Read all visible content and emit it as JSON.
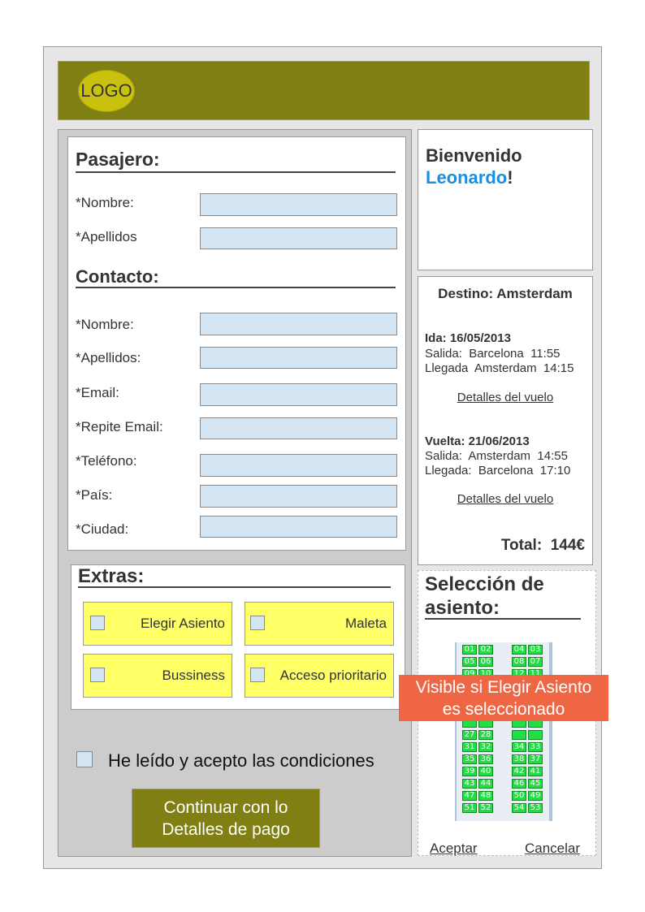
{
  "header": {
    "logo_text": "LOGO"
  },
  "pasajero": {
    "title": "Pasajero:",
    "fields": [
      {
        "label": "*Nombre:",
        "value": ""
      },
      {
        "label": "*Apellidos",
        "value": ""
      }
    ]
  },
  "contacto": {
    "title": "Contacto:",
    "fields": [
      {
        "label": "*Nombre:",
        "value": ""
      },
      {
        "label": "*Apellidos:",
        "value": ""
      },
      {
        "label": "*Email:",
        "value": ""
      },
      {
        "label": "*Repite Email:",
        "value": ""
      },
      {
        "label": "*Teléfono:",
        "value": ""
      },
      {
        "label": "*País:",
        "value": ""
      },
      {
        "label": "*Ciudad:",
        "value": ""
      }
    ]
  },
  "extras": {
    "title": "Extras:",
    "items": [
      {
        "label": "Elegir Asiento",
        "checked": false
      },
      {
        "label": "Maleta",
        "checked": false
      },
      {
        "label": "Bussiness",
        "checked": false
      },
      {
        "label": "Acceso prioritario",
        "checked": false
      }
    ]
  },
  "conditions": {
    "label": "He leído y acepto las condiciones",
    "checked": false
  },
  "continue_button": {
    "line1": "Continuar con lo",
    "line2": "Detalles de pago"
  },
  "welcome": {
    "greeting": "Bienvenido",
    "user_name": "Leonardo",
    "suffix": "!"
  },
  "flight": {
    "destination": "Destino: Amsterdam",
    "outbound": {
      "title": "Ida: 16/05/2013",
      "departure": "Salida:  Barcelona  11:55",
      "arrival": "Llegada  Amsterdam  14:15",
      "details_link": "Detalles del vuelo"
    },
    "return": {
      "title": "Vuelta: 21/06/2013",
      "departure": "Salida:  Amsterdam  14:55",
      "arrival": "Llegada:  Barcelona  17:10",
      "details_link": "Detalles del vuelo"
    },
    "total_label": "Total:",
    "total_value": "144€"
  },
  "seat_selection": {
    "title_line1": "Selección de",
    "title_line2": "asiento:",
    "seat_rows": [
      [
        "01",
        "02",
        "04",
        "03"
      ],
      [
        "05",
        "06",
        "08",
        "07"
      ],
      [
        "09",
        "10",
        "12",
        "11"
      ],
      [
        "",
        "",
        "",
        ""
      ],
      [
        "",
        "",
        "",
        ""
      ],
      [
        "",
        "",
        "",
        ""
      ],
      [
        "",
        "",
        "",
        ""
      ],
      [
        "27",
        "28",
        "",
        ""
      ],
      [
        "31",
        "32",
        "34",
        "33"
      ],
      [
        "35",
        "36",
        "38",
        "37"
      ],
      [
        "39",
        "40",
        "42",
        "41"
      ],
      [
        "43",
        "44",
        "46",
        "45"
      ],
      [
        "47",
        "48",
        "50",
        "49"
      ],
      [
        "51",
        "52",
        "54",
        "53"
      ]
    ],
    "overlay_line1": "Visible si Elegir Asiento",
    "overlay_line2": "es seleccionado",
    "accept_label": "Aceptar",
    "cancel_label": "Cancelar"
  },
  "colors": {
    "header_bg": "#7f7f14",
    "logo_bg": "#c9c10e",
    "input_bg": "#d4e6f4",
    "extra_bg": "#ffff66",
    "seat_green": "#22dd44",
    "overlay_bg": "#ee6644",
    "username_blue": "#1a8fe0"
  }
}
